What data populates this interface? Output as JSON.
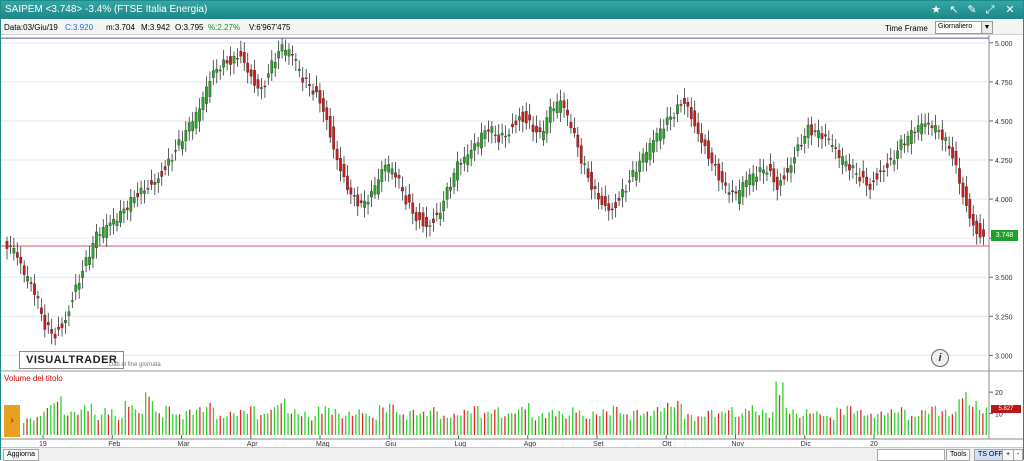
{
  "window": {
    "title": "SAIPEM <3.748> -3.4%  (FTSE Italia Energia)",
    "colors": {
      "accent": "#1d8686",
      "up": "#28a428",
      "down": "#c81e1e",
      "vol_up": "#2bd52b",
      "vol_down": "#e22a2a"
    }
  },
  "infobar": {
    "date": "Data:03/Giu/19",
    "close": "C:3.920",
    "min": "m:3.704",
    "max": "M:3.942",
    "open": "O:3.795",
    "pct": "%:2.27%",
    "volume": "V:6'967'475",
    "timeframe_label": "Time Frame",
    "timeframe_value": "Giornaliero"
  },
  "overlay": {
    "logo": "VISUALTRADER",
    "logo_sub": "Dati di fine giornata",
    "info_icon": "i",
    "volume_label": "Volume del titolo",
    "price_badge": "3.748",
    "volume_badge": "5.827"
  },
  "statusbar": {
    "aggiorna": "Aggiorna",
    "tools": "Tools",
    "ts_off": "TS OFF",
    "plus": "+",
    "minus": "-"
  },
  "chart_data": {
    "type": "candlestick",
    "ylim": [
      2.9,
      5.05
    ],
    "y_ticks": [
      "5.000",
      "4.750",
      "4.500",
      "4.250",
      "4.000",
      "3.750",
      "3.500",
      "3.250",
      "3.000"
    ],
    "x_ticks": [
      "19",
      "Feb",
      "Mar",
      "Apr",
      "Mag",
      "Giu",
      "Lug",
      "Ago",
      "Set",
      "Ott",
      "Nov",
      "Dic",
      "20"
    ],
    "hlines": [
      {
        "value": 3.7,
        "color": "#e0506a"
      },
      {
        "value": 5.03,
        "color": "#5a5aa0"
      }
    ],
    "close_series": [
      3.65,
      3.5,
      3.4,
      3.2,
      3.15,
      3.25,
      3.45,
      3.6,
      3.75,
      3.8,
      3.85,
      3.95,
      4.05,
      4.1,
      4.15,
      4.25,
      4.35,
      4.45,
      4.55,
      4.75,
      4.85,
      4.9,
      4.95,
      4.8,
      4.7,
      4.85,
      4.95,
      4.9,
      4.75,
      4.7,
      4.6,
      4.35,
      4.15,
      4.0,
      3.95,
      4.05,
      4.2,
      4.15,
      4.0,
      3.9,
      3.85,
      3.9,
      4.05,
      4.2,
      4.25,
      4.35,
      4.45,
      4.4,
      4.45,
      4.55,
      4.5,
      4.4,
      4.55,
      4.6,
      4.45,
      4.25,
      4.1,
      4.0,
      3.95,
      4.05,
      4.15,
      4.25,
      4.35,
      4.45,
      4.55,
      4.65,
      4.5,
      4.35,
      4.2,
      4.05,
      4.0,
      4.1,
      4.15,
      4.2,
      4.1,
      4.2,
      4.35,
      4.45,
      4.4,
      4.35,
      4.25,
      4.2,
      4.15,
      4.1,
      4.2,
      4.25,
      4.35,
      4.4,
      4.45,
      4.45,
      4.4,
      4.3,
      4.05,
      3.85,
      3.75
    ],
    "volume_axis": [
      "20",
      "10"
    ],
    "volume": [
      8,
      9,
      14,
      18,
      11,
      12,
      15,
      10,
      13,
      9,
      16,
      12,
      20,
      11,
      14,
      10,
      12,
      13,
      15,
      9,
      11,
      12,
      14,
      10,
      13,
      17,
      12,
      11,
      9,
      14,
      13,
      10,
      11,
      12,
      9,
      14,
      15,
      10,
      12,
      11,
      13,
      9,
      10,
      12,
      14,
      11,
      13,
      10,
      12,
      15,
      9,
      11,
      12,
      10,
      13,
      9,
      11,
      12,
      14,
      10,
      12,
      11,
      13,
      15,
      16,
      10,
      9,
      12,
      11,
      13,
      10,
      14,
      12,
      11,
      26,
      13,
      10,
      12,
      11,
      9,
      13,
      14,
      12,
      10,
      11,
      12,
      13,
      9,
      12,
      14,
      12,
      11,
      20,
      16,
      13
    ]
  }
}
